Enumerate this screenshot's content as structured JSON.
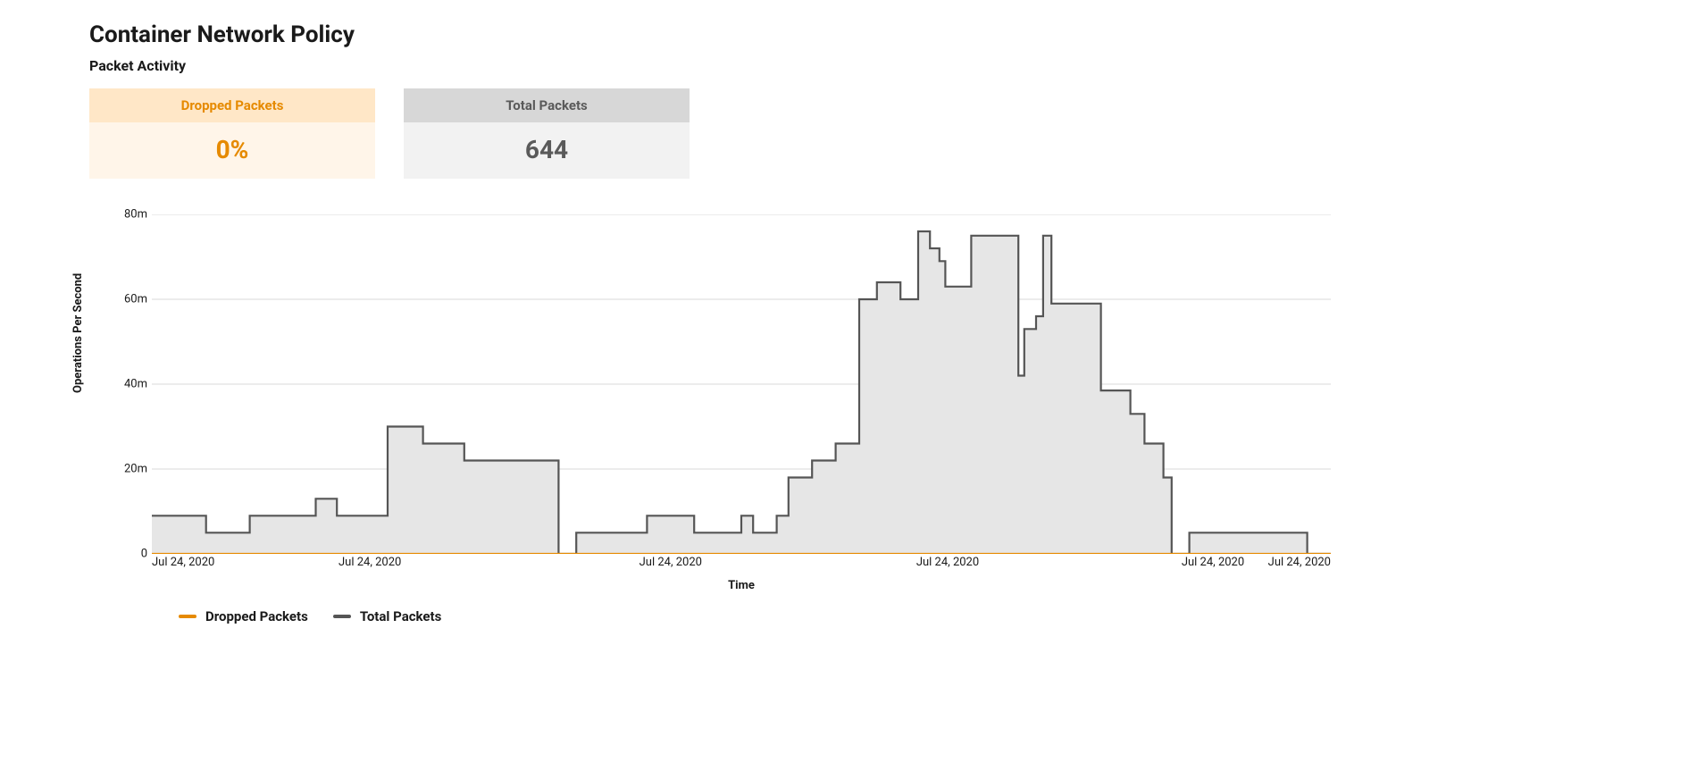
{
  "title": "Container Network Policy",
  "subtitle": "Packet Activity",
  "cards": {
    "dropped": {
      "label": "Dropped Packets",
      "value": "0%"
    },
    "total": {
      "label": "Total Packets",
      "value": "644"
    }
  },
  "chart_data": {
    "type": "area",
    "ylabel": "Operations Per Second",
    "xlabel": "Time",
    "ylim": [
      0,
      80
    ],
    "yticks": [
      "0",
      "20m",
      "40m",
      "60m",
      "80m"
    ],
    "x_tick_labels": [
      "Jul 24, 2020",
      "Jul 24, 2020",
      "Jul 24, 2020",
      "Jul 24, 2020",
      "Jul 24, 2020",
      "Jul 24, 2020"
    ],
    "x_tick_positions": [
      0,
      18.5,
      44,
      67.5,
      90,
      100
    ],
    "legend": [
      {
        "name": "Dropped Packets",
        "color": "#e68a00"
      },
      {
        "name": "Total Packets",
        "color": "#555555"
      }
    ],
    "series": [
      {
        "name": "Total Packets",
        "color": "#555555",
        "filled": true,
        "points": [
          [
            0.0,
            9.0
          ],
          [
            4.6,
            9.0
          ],
          [
            4.6,
            5.0
          ],
          [
            8.3,
            5.0
          ],
          [
            8.3,
            9.0
          ],
          [
            13.9,
            9.0
          ],
          [
            13.9,
            13.0
          ],
          [
            15.7,
            13.0
          ],
          [
            15.7,
            9.0
          ],
          [
            18.0,
            9.0
          ],
          [
            18.0,
            9.0
          ],
          [
            20.0,
            9.0
          ],
          [
            20.0,
            30.0
          ],
          [
            23.0,
            30.0
          ],
          [
            23.0,
            26.0
          ],
          [
            26.5,
            26.0
          ],
          [
            26.5,
            22.0
          ],
          [
            34.5,
            22.0
          ],
          [
            34.5,
            0.0
          ],
          [
            36.0,
            0.0
          ],
          [
            36.0,
            5.0
          ],
          [
            42.0,
            5.0
          ],
          [
            42.0,
            9.0
          ],
          [
            46.0,
            9.0
          ],
          [
            46.0,
            5.0
          ],
          [
            50.0,
            5.0
          ],
          [
            50.0,
            9.0
          ],
          [
            51.0,
            9.0
          ],
          [
            51.0,
            5.0
          ],
          [
            53.0,
            5.0
          ],
          [
            53.0,
            9.0
          ],
          [
            54.0,
            9.0
          ],
          [
            54.0,
            18.0
          ],
          [
            56.0,
            18.0
          ],
          [
            56.0,
            22.0
          ],
          [
            58.0,
            22.0
          ],
          [
            58.0,
            26.0
          ],
          [
            60.0,
            26.0
          ],
          [
            60.0,
            60.0
          ],
          [
            61.5,
            60.0
          ],
          [
            61.5,
            64.0
          ],
          [
            63.5,
            64.0
          ],
          [
            63.5,
            60.0
          ],
          [
            65.0,
            60.0
          ],
          [
            65.0,
            76.0
          ],
          [
            66.0,
            76.0
          ],
          [
            66.0,
            72.0
          ],
          [
            66.8,
            72.0
          ],
          [
            66.8,
            69.0
          ],
          [
            67.3,
            69.0
          ],
          [
            67.3,
            63.0
          ],
          [
            69.5,
            63.0
          ],
          [
            69.5,
            75.0
          ],
          [
            73.5,
            75.0
          ],
          [
            73.5,
            42.0
          ],
          [
            74.0,
            42.0
          ],
          [
            74.0,
            53.0
          ],
          [
            75.0,
            53.0
          ],
          [
            75.0,
            56.0
          ],
          [
            75.6,
            56.0
          ],
          [
            75.6,
            75.0
          ],
          [
            76.3,
            75.0
          ],
          [
            76.3,
            59.0
          ],
          [
            80.5,
            59.0
          ],
          [
            80.5,
            38.5
          ],
          [
            83.0,
            38.5
          ],
          [
            83.0,
            33.0
          ],
          [
            84.2,
            33.0
          ],
          [
            84.2,
            26.0
          ],
          [
            85.8,
            26.0
          ],
          [
            85.8,
            18.0
          ],
          [
            86.5,
            18.0
          ],
          [
            86.5,
            0.0
          ],
          [
            88.0,
            0.0
          ],
          [
            88.0,
            5.0
          ],
          [
            98.0,
            5.0
          ],
          [
            98.0,
            0.0
          ],
          [
            100.0,
            0.0
          ]
        ]
      },
      {
        "name": "Dropped Packets",
        "color": "#e68a00",
        "filled": false,
        "points": [
          [
            0.0,
            0.0
          ],
          [
            100.0,
            0.0
          ]
        ]
      }
    ]
  }
}
